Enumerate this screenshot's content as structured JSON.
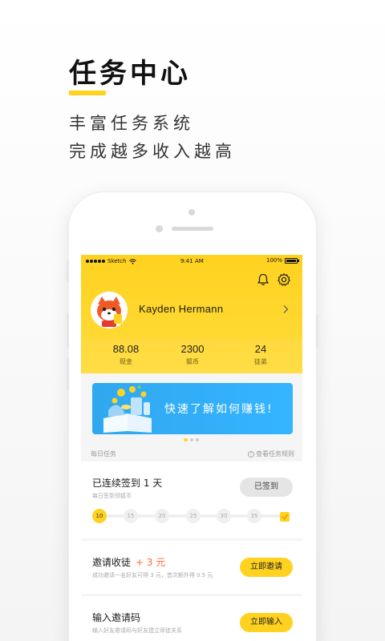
{
  "hero": {
    "title": "任务中心",
    "line1": "丰富任务系统",
    "line2": "完成越多收入越高"
  },
  "status_bar": {
    "carrier": "Sketch",
    "time": "9:41 AM",
    "battery": "100%"
  },
  "profile": {
    "name": "Kayden Hermann"
  },
  "stats": [
    {
      "value": "88.08",
      "label": "现金"
    },
    {
      "value": "2300",
      "label": "狐币"
    },
    {
      "value": "24",
      "label": "徒弟"
    }
  ],
  "banner": {
    "text": "快速了解如何赚钱!"
  },
  "daily": {
    "header": "每日任务",
    "rules": "查看任务规则"
  },
  "checkin": {
    "title": "已连续签到 1 天",
    "desc": "每日签到领狐币",
    "button": "已签到",
    "progress": 1,
    "steps": [
      "10",
      "15",
      "20",
      "25",
      "30",
      "35"
    ]
  },
  "invite": {
    "title": "邀请收徒",
    "reward": "+ 3 元",
    "desc": "成功邀请一名好友可得 3 元，首次额外得 0.5 元",
    "button": "立即邀请"
  },
  "code": {
    "title": "输入邀请码",
    "desc": "输入好友邀请码与好友建立师徒关系",
    "button": "立即输入"
  },
  "colors": {
    "accent": "#ffd21f",
    "banner": "#2fa8f0",
    "reward": "#ff6a3a"
  }
}
